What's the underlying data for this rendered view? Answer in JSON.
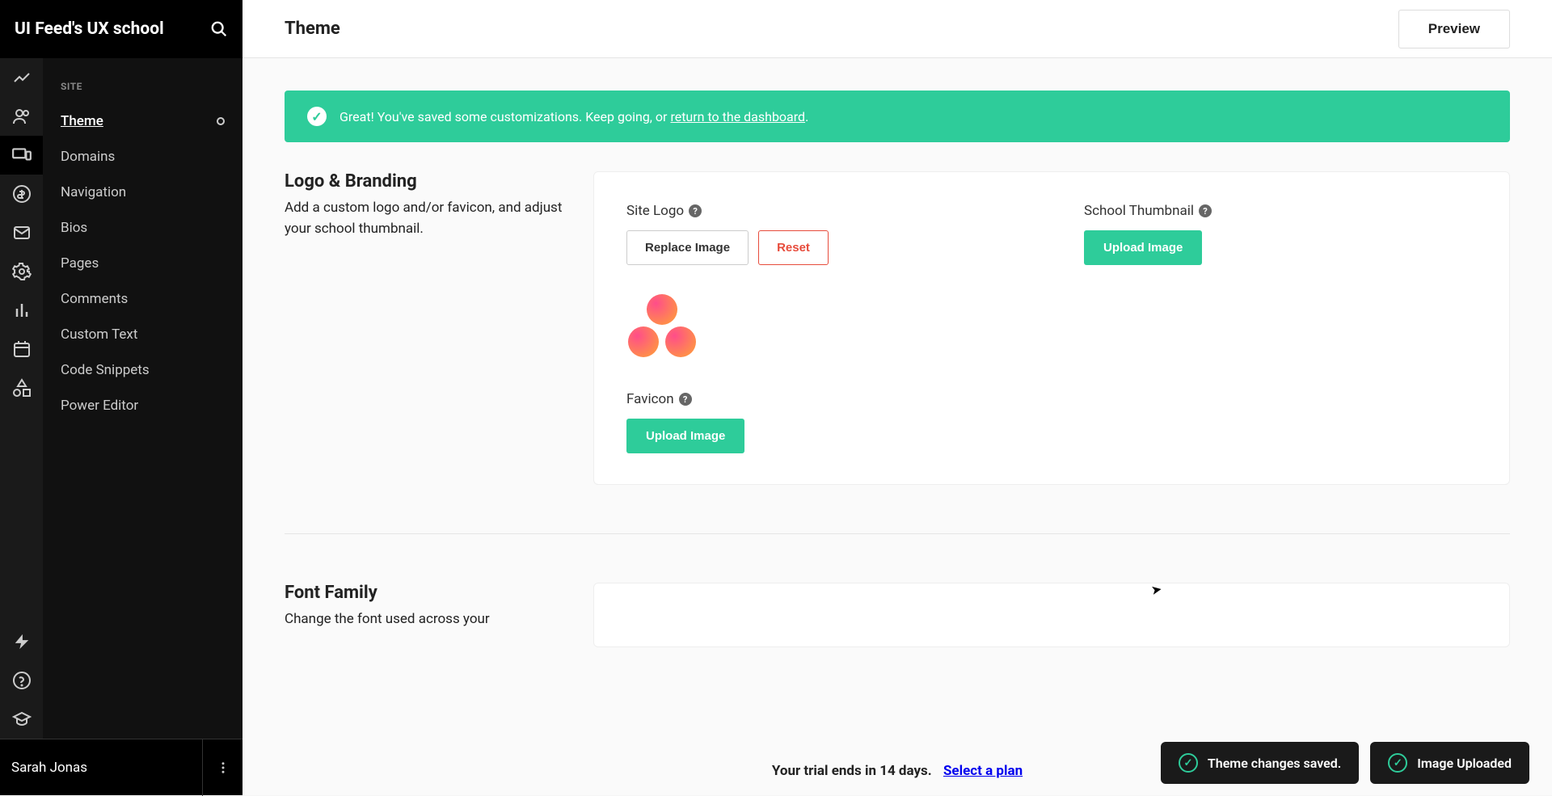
{
  "brand": "UI Feed's UX school",
  "header": {
    "title": "Theme",
    "preview_label": "Preview"
  },
  "side_group": "SITE",
  "sidebar_items": [
    {
      "label": "Theme",
      "active": true,
      "indicator": true
    },
    {
      "label": "Domains"
    },
    {
      "label": "Navigation"
    },
    {
      "label": "Bios"
    },
    {
      "label": "Pages"
    },
    {
      "label": "Comments"
    },
    {
      "label": "Custom Text"
    },
    {
      "label": "Code Snippets"
    },
    {
      "label": "Power Editor"
    }
  ],
  "user": "Sarah Jonas",
  "alert": {
    "text": "Great! You've saved some customizations. Keep going, or ",
    "link": "return to the dashboard",
    "suffix": "."
  },
  "branding": {
    "title": "Logo & Branding",
    "desc": "Add a custom logo and/or favicon, and adjust your school thumbnail.",
    "site_logo_label": "Site Logo",
    "replace_label": "Replace Image",
    "reset_label": "Reset",
    "school_thumb_label": "School Thumbnail",
    "upload_label": "Upload Image",
    "favicon_label": "Favicon",
    "favicon_upload_label": "Upload Image"
  },
  "font": {
    "title": "Font Family",
    "desc": "Change the font used across your"
  },
  "trial": {
    "text": "Your trial ends in 14 days.",
    "link": "Select a plan"
  },
  "toasts": {
    "t1": "Theme changes saved.",
    "t2": "Image Uploaded"
  },
  "icon_rail": [
    "analytics",
    "users",
    "devices",
    "billing",
    "email",
    "settings",
    "reports",
    "calendar",
    "shapes"
  ],
  "icon_rail_bottom": [
    "bolt",
    "help",
    "education"
  ]
}
